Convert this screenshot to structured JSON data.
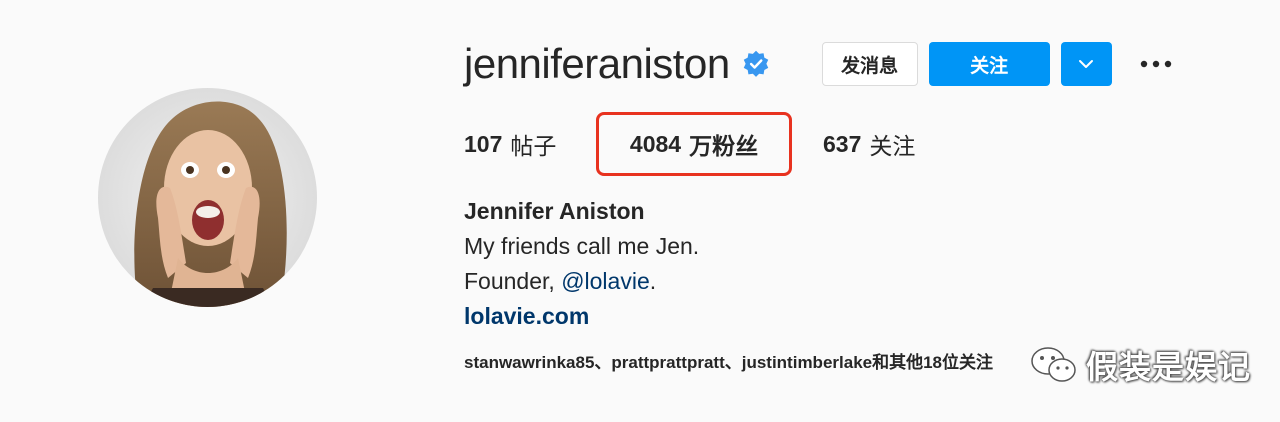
{
  "profile": {
    "username": "jenniferaniston",
    "verified_icon": "verified-badge-icon",
    "full_name": "Jennifer Aniston",
    "bio_line1": "My friends call me Jen.",
    "bio_line2_prefix": "Founder, ",
    "bio_line2_mention": "@lolavie",
    "bio_line2_suffix": ".",
    "website": "lolavie.com",
    "avatar_icon": "profile-photo"
  },
  "actions": {
    "message_label": "发消息",
    "follow_label": "关注",
    "dropdown_icon": "chevron-down-icon",
    "more_icon": "more-dots-icon"
  },
  "stats": {
    "posts_value": "107",
    "posts_label": "帖子",
    "followers_value": "4084",
    "followers_label": "万粉丝",
    "following_value": "637",
    "following_label": "关注"
  },
  "followed_by": {
    "text": "stanwawrinka85、prattprattpratt、justintimberlake和其他18位",
    "suffix": "关注"
  },
  "watermark": {
    "text": "假装是娱记",
    "icon": "wechat-icon"
  },
  "colors": {
    "accent": "#0095f6",
    "highlight_box": "#e8321f",
    "link": "#00376b",
    "background": "#fafafa"
  }
}
